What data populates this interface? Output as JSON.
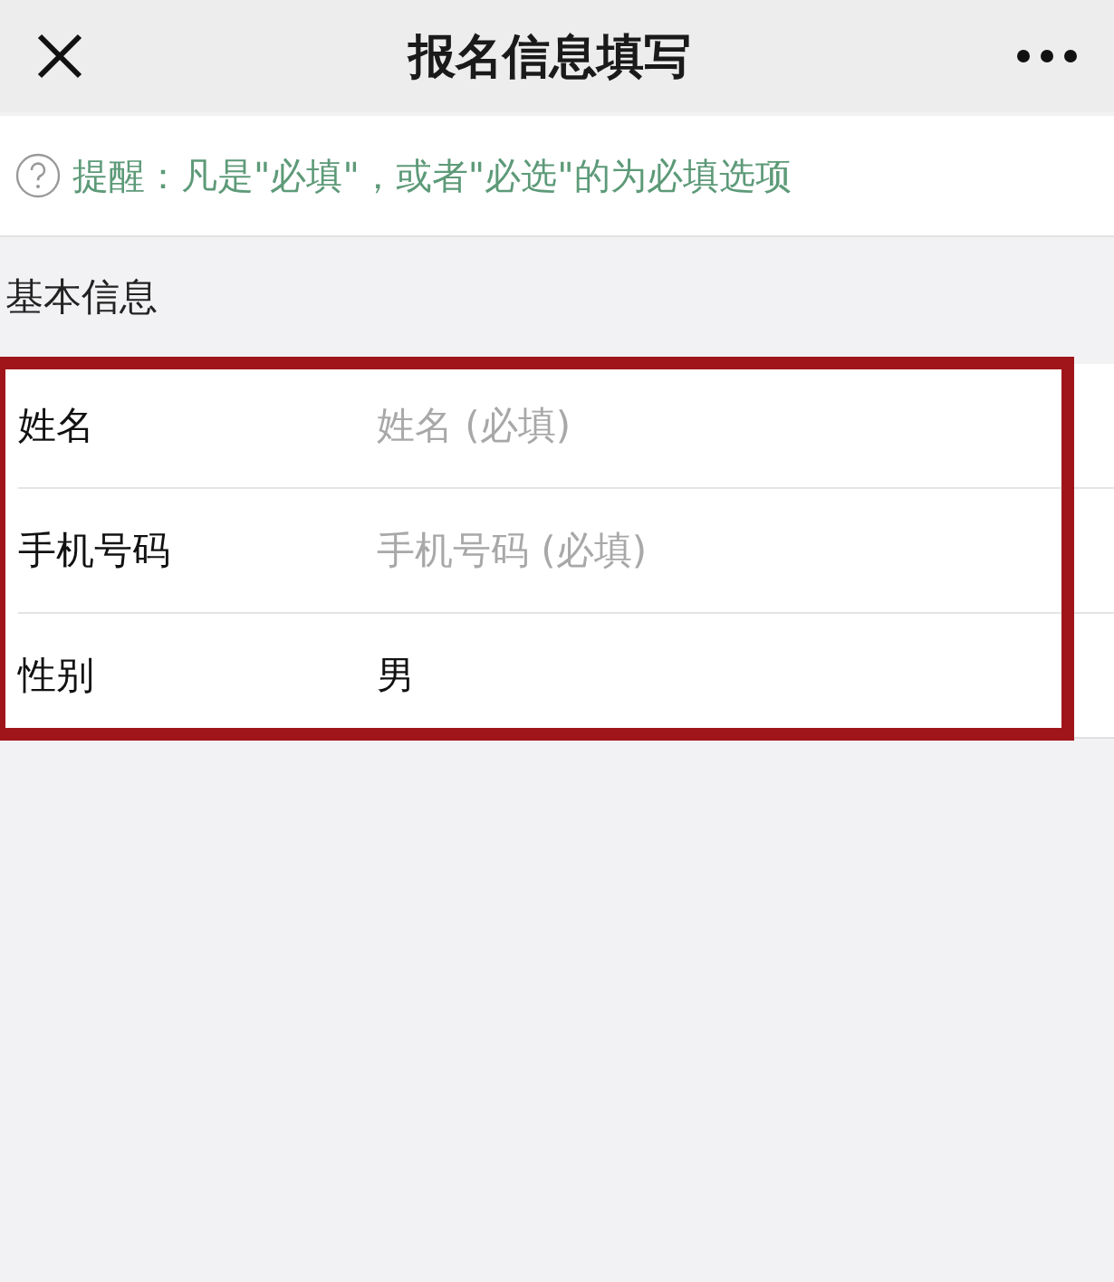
{
  "header": {
    "title": "报名信息填写"
  },
  "notice": {
    "text": "提醒：凡是\"必填\"，或者\"必选\"的为必填选项"
  },
  "section": {
    "title": "基本信息"
  },
  "fields": [
    {
      "label": "姓名",
      "placeholder": "姓名 (必填)"
    },
    {
      "label": "手机号码",
      "placeholder": "手机号码 (必填)"
    },
    {
      "label": "性别",
      "value": "男"
    }
  ],
  "highlight": {
    "color": "#a0151a"
  }
}
